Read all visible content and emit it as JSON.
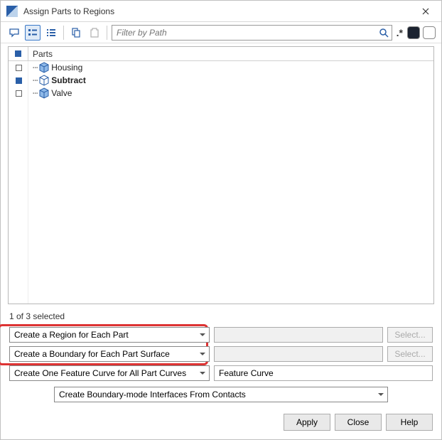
{
  "window": {
    "title": "Assign Parts to Regions"
  },
  "toolbar": {
    "filter_placeholder": "Filter by Path",
    "wildcard_label": ".*"
  },
  "tree": {
    "header_checkbox_checked": true,
    "header_label": "Parts",
    "items": [
      {
        "label": "Housing",
        "bold": false,
        "checked": false
      },
      {
        "label": "Subtract",
        "bold": true,
        "checked": true
      },
      {
        "label": "Valve",
        "bold": false,
        "checked": false
      }
    ]
  },
  "selection_status": "1 of 3 selected",
  "options": {
    "row1": {
      "select": "Create a Region for Each Part",
      "text": "",
      "button": "Select...",
      "button_enabled": false,
      "text_enabled": false
    },
    "row2": {
      "select": "Create a Boundary for Each Part Surface",
      "text": "",
      "button": "Select...",
      "button_enabled": false,
      "text_enabled": false
    },
    "row3": {
      "select": "Create One Feature Curve for All Part Curves",
      "text": "Feature Curve",
      "button": null,
      "text_enabled": true
    },
    "row4": {
      "select": "Create Boundary-mode Interfaces From Contacts"
    }
  },
  "footer": {
    "apply": "Apply",
    "close": "Close",
    "help": "Help"
  },
  "icons": {
    "box_color_1": "#3a78c7",
    "box_color_2": "#8db8e8"
  }
}
